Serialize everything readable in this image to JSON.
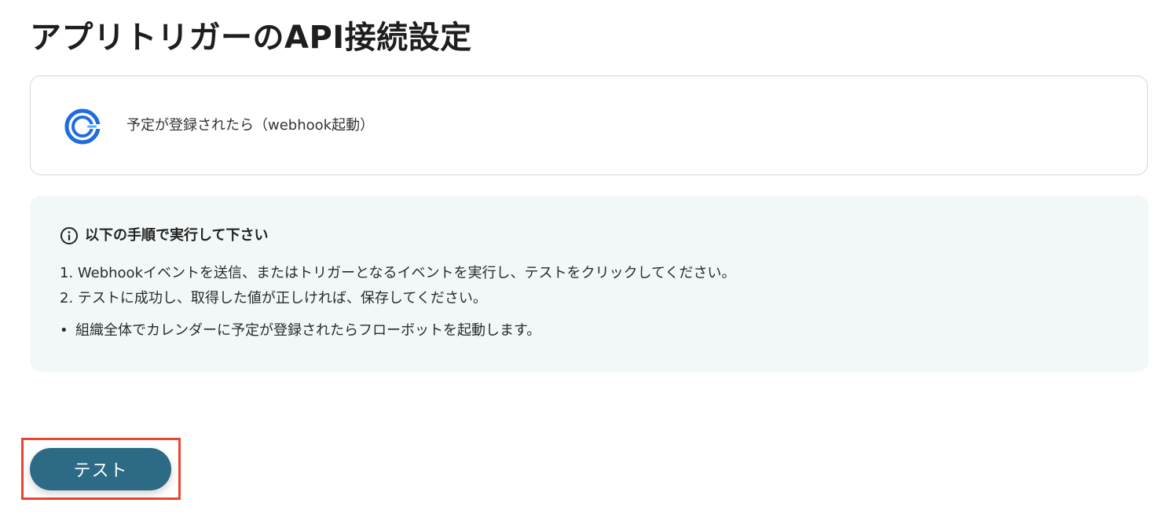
{
  "page": {
    "title": "アプリトリガーのAPI接続設定"
  },
  "trigger": {
    "app_icon": "calendly-logo",
    "label": "予定が登録されたら（webhook起動）"
  },
  "info": {
    "icon": "info-circle-icon",
    "title": "以下の手順で実行して下さい",
    "steps": [
      "1. Webhookイベントを送信、またはトリガーとなるイベントを実行し、テストをクリックしてください。",
      "2. テストに成功し、取得した値が正しければ、保存してください。"
    ],
    "notes": [
      "組織全体でカレンダーに予定が登録されたらフローボットを起動します。"
    ],
    "bullet": "•"
  },
  "actions": {
    "test_button_label": "テスト"
  },
  "colors": {
    "accent": "#2c6a86",
    "info_background": "#f2f8f8",
    "highlight": "#e8462f",
    "logo_blue": "#1f6be0"
  }
}
